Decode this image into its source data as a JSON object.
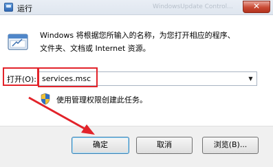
{
  "window": {
    "title": "运行",
    "background_window_text": "WindowsUpdate Control..."
  },
  "description": {
    "line1": "Windows 将根据您所输入的名称，为您打开相应的程序、",
    "line2": "文件夹、文档或 Internet 资源。"
  },
  "open_field": {
    "label": "打开(O):",
    "value": "services.msc"
  },
  "admin_note": "使用管理权限创建此任务。",
  "buttons": {
    "ok": "确定",
    "cancel": "取消",
    "browse": "浏览(B)..."
  },
  "colors": {
    "highlight": "#e2232a",
    "footer": "#f0f0f0"
  },
  "icons": [
    "run-app-icon",
    "run-dialog-icon",
    "uac-shield-icon",
    "chevron-down-icon"
  ]
}
